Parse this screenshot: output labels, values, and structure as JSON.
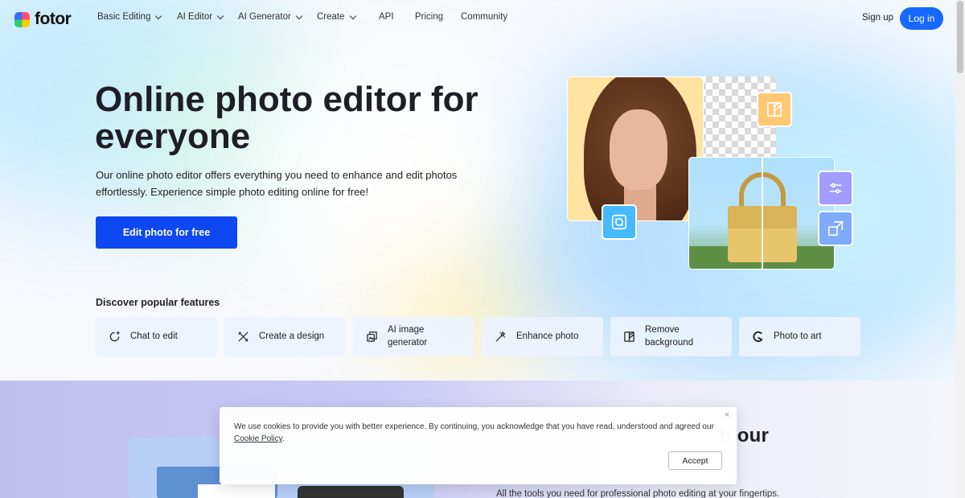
{
  "header": {
    "logo_text": "fotor",
    "menu": [
      {
        "label": "Basic Editing",
        "dropdown": true
      },
      {
        "label": "AI Editor",
        "dropdown": true
      },
      {
        "label": "AI Generator",
        "dropdown": true
      },
      {
        "label": "Create",
        "dropdown": true
      },
      {
        "label": "API",
        "dropdown": false
      },
      {
        "label": "Pricing",
        "dropdown": false
      },
      {
        "label": "Community",
        "dropdown": false
      }
    ],
    "signup_label": "Sign up",
    "login_label": "Log in"
  },
  "hero": {
    "title": "Online photo editor for everyone",
    "description": "Our online photo editor offers everything you need to enhance and edit photos effortlessly. Experience simple photo editing online for free!",
    "cta_label": "Edit photo for free"
  },
  "features": {
    "title": "Discover popular features",
    "items": [
      {
        "label": "Chat to edit",
        "icon": "sparkle-chat-icon"
      },
      {
        "label": "Create a design",
        "icon": "design-tools-icon"
      },
      {
        "label": "AI image generator",
        "icon": "ai-image-icon"
      },
      {
        "label": "Enhance photo",
        "icon": "magic-wand-icon"
      },
      {
        "label": "Remove background",
        "icon": "remove-bg-icon"
      },
      {
        "label": "Photo to art",
        "icon": "art-brush-icon"
      }
    ]
  },
  "lower": {
    "heading_visible": "h our",
    "subtitle": "All the tools you need for professional photo editing at your fingertips."
  },
  "cookie": {
    "text": "We use cookies to provide you with better experience. By continuing, you acknowledge that you have read, understood and agreed our",
    "link_label": "Cookie Policy",
    "suffix": ".",
    "close_label": "×",
    "accept_label": "Accept"
  },
  "colors": {
    "primary": "#0d48f2",
    "login_button": "#1668ff",
    "text_dark": "#1e1e26"
  }
}
